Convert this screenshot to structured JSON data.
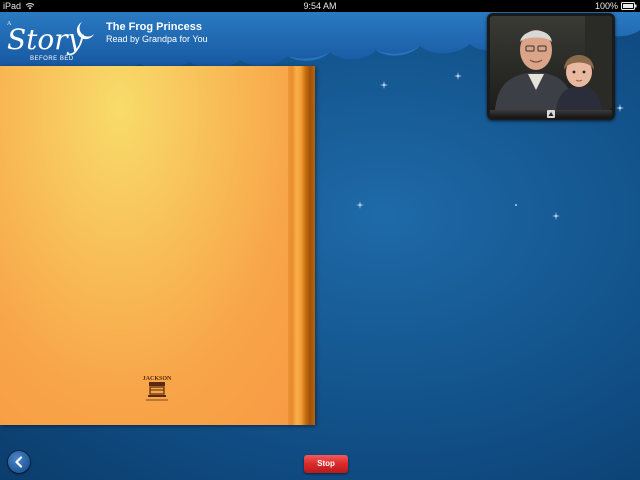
{
  "status_bar": {
    "device": "iPad",
    "time": "9:54 AM",
    "battery": "100%",
    "wifi_icon": "wifi-icon",
    "battery_icon": "battery-icon"
  },
  "header": {
    "logo_text": "A Story Before Bed",
    "title": "The Frog Princess",
    "subtitle": "Read by Grandpa for You"
  },
  "video": {
    "toggle_icon": "chevron-up-icon"
  },
  "book": {
    "publisher_logo": "JACKSON"
  },
  "controls": {
    "back_icon": "chevron-left-icon",
    "stop_label": "Stop"
  },
  "colors": {
    "background": "#165a94",
    "header_clouds": "#1a5fa8",
    "book_page": "#f8a448",
    "stop_button": "#d92a2a",
    "title_text": "#ffffff"
  }
}
